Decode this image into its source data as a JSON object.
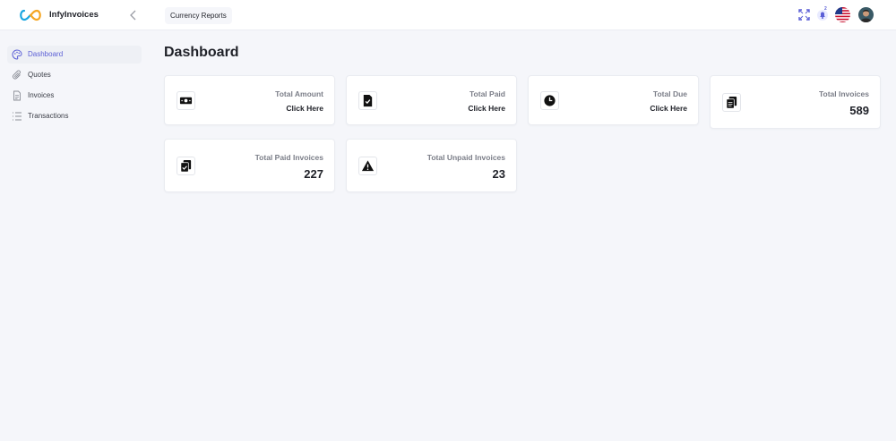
{
  "app": {
    "name": "InfyInvoices"
  },
  "header": {
    "currency_reports_label": "Currency Reports",
    "notification_count": "2"
  },
  "sidebar": {
    "items": [
      {
        "label": "Dashboard",
        "icon": "palette-icon",
        "active": true
      },
      {
        "label": "Quotes",
        "icon": "paperclip-icon",
        "active": false
      },
      {
        "label": "Invoices",
        "icon": "document-icon",
        "active": false
      },
      {
        "label": "Transactions",
        "icon": "list-icon",
        "active": false
      }
    ]
  },
  "main": {
    "title": "Dashboard",
    "cards": [
      {
        "label": "Total Amount",
        "link": "Click Here",
        "icon": "money-icon"
      },
      {
        "label": "Total Paid",
        "link": "Click Here",
        "icon": "file-check-icon"
      },
      {
        "label": "Total Due",
        "link": "Click Here",
        "icon": "clock-icon"
      },
      {
        "label": "Total Invoices",
        "value": "589",
        "icon": "clipboard-icon"
      },
      {
        "label": "Total Paid Invoices",
        "value": "227",
        "icon": "clipboard-check-icon"
      },
      {
        "label": "Total Unpaid Invoices",
        "value": "23",
        "icon": "warning-icon"
      }
    ]
  },
  "colors": {
    "accent": "#5b5fd6",
    "background": "#f5f6fa",
    "card": "#ffffff"
  }
}
